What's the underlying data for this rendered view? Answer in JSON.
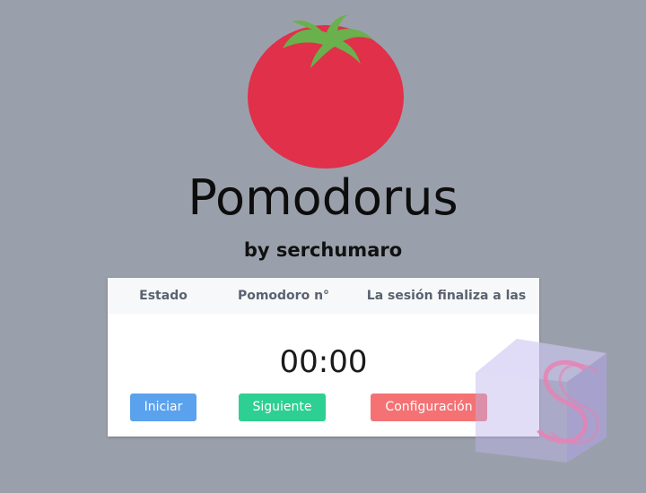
{
  "app": {
    "title": "Pomodorus",
    "subtitle": "by serchumaro"
  },
  "table": {
    "columns": [
      "Estado",
      "Pomodoro n°",
      "La sesión finaliza a las"
    ]
  },
  "timer": {
    "display": "00:00"
  },
  "buttons": {
    "start": "Iniciar",
    "next": "Siguiente",
    "config": "Configuración"
  },
  "colors": {
    "background": "#9aa0ab",
    "tomato": "#e0304a",
    "leaves": "#6ab04c",
    "start": "#5aa2ee",
    "next": "#2ecf92",
    "config": "#f47274"
  },
  "icons": {
    "logo": "tomato-icon",
    "watermark": "ss-watermark-icon"
  }
}
